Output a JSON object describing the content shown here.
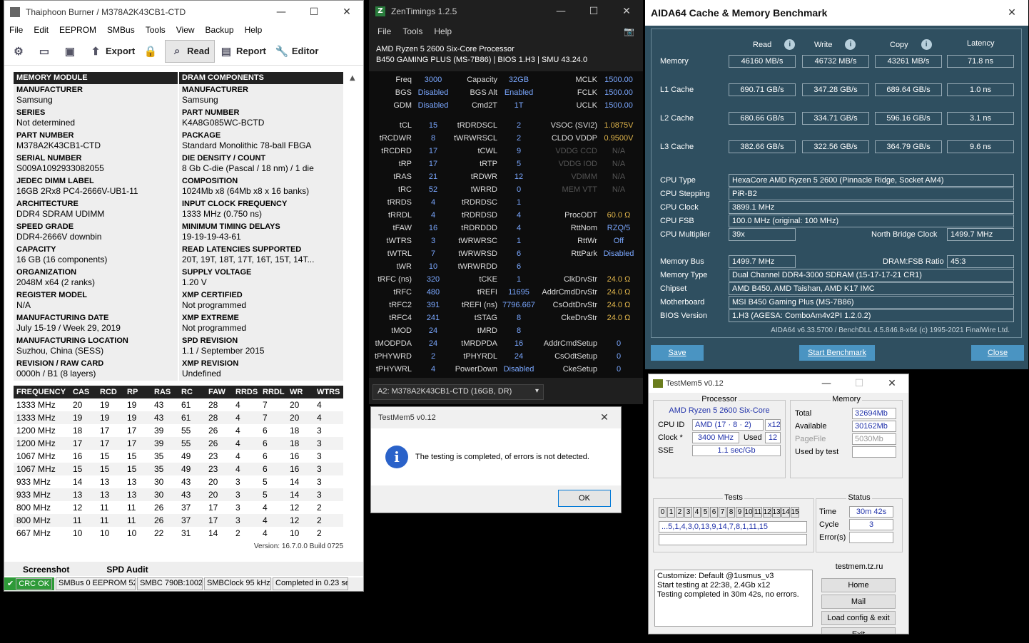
{
  "thaiphoon": {
    "title": "Thaiphoon Burner / M378A2K43CB1-CTD",
    "menu": [
      "File",
      "Edit",
      "EEPROM",
      "SMBus",
      "Tools",
      "View",
      "Backup",
      "Help"
    ],
    "toolbar": {
      "export": "Export",
      "read": "Read",
      "report": "Report",
      "editor": "Editor"
    },
    "spd_headers": [
      "MEMORY MODULE",
      "DRAM COMPONENTS"
    ],
    "spd_rows": [
      [
        {
          "k": "MANUFACTURER",
          "v": "Samsung"
        },
        {
          "k": "MANUFACTURER",
          "v": "Samsung"
        }
      ],
      [
        {
          "k": "SERIES",
          "v": "Not determined"
        },
        {
          "k": "PART NUMBER",
          "v": "K4A8G085WC-BCTD"
        }
      ],
      [
        {
          "k": "PART NUMBER",
          "v": "M378A2K43CB1-CTD"
        },
        {
          "k": "PACKAGE",
          "v": "Standard Monolithic 78-ball FBGA"
        }
      ],
      [
        {
          "k": "SERIAL NUMBER",
          "v": "S009A1092933082055"
        },
        {
          "k": "DIE DENSITY / COUNT",
          "v": "8 Gb C-die (Pascal / 18 nm) / 1 die"
        }
      ],
      [
        {
          "k": "JEDEC DIMM LABEL",
          "v": "16GB 2Rx8 PC4-2666V-UB1-11"
        },
        {
          "k": "COMPOSITION",
          "v": "1024Mb x8 (64Mb x8 x 16 banks)"
        }
      ],
      [
        {
          "k": "ARCHITECTURE",
          "v": "DDR4 SDRAM UDIMM"
        },
        {
          "k": "INPUT CLOCK FREQUENCY",
          "v": "1333 MHz (0.750 ns)"
        }
      ],
      [
        {
          "k": "SPEED GRADE",
          "v": "DDR4-2666V downbin"
        },
        {
          "k": "MINIMUM TIMING DELAYS",
          "v": "19-19-19-43-61"
        }
      ],
      [
        {
          "k": "CAPACITY",
          "v": "16 GB (16 components)"
        },
        {
          "k": "READ LATENCIES SUPPORTED",
          "v": "20T, 19T, 18T, 17T, 16T, 15T, 14T..."
        }
      ],
      [
        {
          "k": "ORGANIZATION",
          "v": "2048M x64 (2 ranks)"
        },
        {
          "k": "SUPPLY VOLTAGE",
          "v": "1.20 V"
        }
      ],
      [
        {
          "k": "REGISTER MODEL",
          "v": "N/A"
        },
        {
          "k": "XMP CERTIFIED",
          "v": "Not programmed"
        }
      ],
      [
        {
          "k": "MANUFACTURING DATE",
          "v": "July 15-19 / Week 29, 2019"
        },
        {
          "k": "XMP EXTREME",
          "v": "Not programmed"
        }
      ],
      [
        {
          "k": "MANUFACTURING LOCATION",
          "v": "Suzhou, China (SESS)"
        },
        {
          "k": "SPD REVISION",
          "v": "1.1 / September 2015"
        }
      ],
      [
        {
          "k": "REVISION / RAW CARD",
          "v": "0000h / B1 (8 layers)"
        },
        {
          "k": "XMP REVISION",
          "v": "Undefined"
        }
      ]
    ],
    "freq_header": [
      "FREQUENCY",
      "CAS",
      "RCD",
      "RP",
      "RAS",
      "RC",
      "FAW",
      "RRDS",
      "RRDL",
      "WR",
      "WTRS"
    ],
    "freq_rows": [
      [
        "1333 MHz",
        "20",
        "19",
        "19",
        "43",
        "61",
        "28",
        "4",
        "7",
        "20",
        "4"
      ],
      [
        "1333 MHz",
        "19",
        "19",
        "19",
        "43",
        "61",
        "28",
        "4",
        "7",
        "20",
        "4"
      ],
      [
        "1200 MHz",
        "18",
        "17",
        "17",
        "39",
        "55",
        "26",
        "4",
        "6",
        "18",
        "3"
      ],
      [
        "1200 MHz",
        "17",
        "17",
        "17",
        "39",
        "55",
        "26",
        "4",
        "6",
        "18",
        "3"
      ],
      [
        "1067 MHz",
        "16",
        "15",
        "15",
        "35",
        "49",
        "23",
        "4",
        "6",
        "16",
        "3"
      ],
      [
        "1067 MHz",
        "15",
        "15",
        "15",
        "35",
        "49",
        "23",
        "4",
        "6",
        "16",
        "3"
      ],
      [
        "933 MHz",
        "14",
        "13",
        "13",
        "30",
        "43",
        "20",
        "3",
        "5",
        "14",
        "3"
      ],
      [
        "933 MHz",
        "13",
        "13",
        "13",
        "30",
        "43",
        "20",
        "3",
        "5",
        "14",
        "3"
      ],
      [
        "800 MHz",
        "12",
        "11",
        "11",
        "26",
        "37",
        "17",
        "3",
        "4",
        "12",
        "2"
      ],
      [
        "800 MHz",
        "11",
        "11",
        "11",
        "26",
        "37",
        "17",
        "3",
        "4",
        "12",
        "2"
      ],
      [
        "667 MHz",
        "10",
        "10",
        "10",
        "22",
        "31",
        "14",
        "2",
        "4",
        "10",
        "2"
      ]
    ],
    "version": "Version: 16.7.0.0 Build 0725",
    "tabs": [
      "Screenshot",
      "SPD Audit"
    ],
    "status": [
      "CRC OK",
      "SMBus 0 EEPROM 52h",
      "SMBC 790B:1002",
      "SMBClock 95 kHz",
      "Completed in 0.23 sec"
    ]
  },
  "zen": {
    "title": "ZenTimings 1.2.5",
    "menu": [
      "File",
      "Tools",
      "Help"
    ],
    "cpu": "AMD Ryzen 5 2600 Six-Core Processor",
    "board": "B450 GAMING PLUS (MS-7B86) | BIOS 1.H3 | SMU 43.24.0",
    "rows": [
      [
        [
          "Freq",
          "3000"
        ],
        [
          "Capacity",
          "32GB"
        ],
        [
          "MCLK",
          "1500.00"
        ]
      ],
      [
        [
          "BGS",
          "Disabled"
        ],
        [
          "BGS Alt",
          "Enabled"
        ],
        [
          "FCLK",
          "1500.00"
        ]
      ],
      [
        [
          "GDM",
          "Disabled"
        ],
        [
          "Cmd2T",
          "1T"
        ],
        [
          "UCLK",
          "1500.00"
        ]
      ],
      [
        [
          "tCL",
          "15"
        ],
        [
          "tRDRDSCL",
          "2"
        ],
        [
          "VSOC (SVI2)",
          "1.0875V"
        ]
      ],
      [
        [
          "tRCDWR",
          "8"
        ],
        [
          "tWRWRSCL",
          "2"
        ],
        [
          "CLDO VDDP",
          "0.9500V"
        ]
      ],
      [
        [
          "tRCDRD",
          "17"
        ],
        [
          "tCWL",
          "9"
        ],
        [
          "VDDG CCD",
          "N/A"
        ]
      ],
      [
        [
          "tRP",
          "17"
        ],
        [
          "tRTP",
          "5"
        ],
        [
          "VDDG IOD",
          "N/A"
        ]
      ],
      [
        [
          "tRAS",
          "21"
        ],
        [
          "tRDWR",
          "12"
        ],
        [
          "VDIMM",
          "N/A"
        ]
      ],
      [
        [
          "tRC",
          "52"
        ],
        [
          "tWRRD",
          "0"
        ],
        [
          "MEM VTT",
          "N/A"
        ]
      ],
      [
        [
          "tRRDS",
          "4"
        ],
        [
          "tRDRDSC",
          "1"
        ],
        [
          "",
          ""
        ]
      ],
      [
        [
          "tRRDL",
          "4"
        ],
        [
          "tRDRDSD",
          "4"
        ],
        [
          "ProcODT",
          "60.0 Ω"
        ]
      ],
      [
        [
          "tFAW",
          "16"
        ],
        [
          "tRDRDDD",
          "4"
        ],
        [
          "RttNom",
          "RZQ/5"
        ]
      ],
      [
        [
          "tWTRS",
          "3"
        ],
        [
          "tWRWRSC",
          "1"
        ],
        [
          "RttWr",
          "Off"
        ]
      ],
      [
        [
          "tWTRL",
          "7"
        ],
        [
          "tWRWRSD",
          "6"
        ],
        [
          "RttPark",
          "Disabled"
        ]
      ],
      [
        [
          "tWR",
          "10"
        ],
        [
          "tWRWRDD",
          "6"
        ],
        [
          "",
          ""
        ]
      ],
      [
        [
          "tRFC (ns)",
          "320"
        ],
        [
          "tCKE",
          "1"
        ],
        [
          "ClkDrvStr",
          "24.0 Ω"
        ]
      ],
      [
        [
          "tRFC",
          "480"
        ],
        [
          "tREFI",
          "11695"
        ],
        [
          "AddrCmdDrvStr",
          "24.0 Ω"
        ]
      ],
      [
        [
          "tRFC2",
          "391"
        ],
        [
          "tREFI (ns)",
          "7796.667"
        ],
        [
          "CsOdtDrvStr",
          "24.0 Ω"
        ]
      ],
      [
        [
          "tRFC4",
          "241"
        ],
        [
          "tSTAG",
          "8"
        ],
        [
          "CkeDrvStr",
          "24.0 Ω"
        ]
      ],
      [
        [
          "tMOD",
          "24"
        ],
        [
          "tMRD",
          "8"
        ],
        [
          "",
          ""
        ]
      ],
      [
        [
          "tMODPDA",
          "24"
        ],
        [
          "tMRDPDA",
          "16"
        ],
        [
          "AddrCmdSetup",
          "0"
        ]
      ],
      [
        [
          "tPHYWRD",
          "2"
        ],
        [
          "tPHYRDL",
          "24"
        ],
        [
          "CsOdtSetup",
          "0"
        ]
      ],
      [
        [
          "tPHYWRL",
          "4"
        ],
        [
          "PowerDown",
          "Disabled"
        ],
        [
          "CkeSetup",
          "0"
        ]
      ]
    ],
    "selector": "A2: M378A2K43CB1-CTD (16GB, DR)"
  },
  "tm_dialog": {
    "title": "TestMem5 v0.12",
    "message": "The testing is completed, of errors is not detected.",
    "ok": "OK"
  },
  "aida": {
    "title": "AIDA64 Cache & Memory Benchmark",
    "cols": [
      "Read",
      "Write",
      "Copy",
      "Latency"
    ],
    "rows": [
      {
        "label": "Memory",
        "vals": [
          "46160 MB/s",
          "46732 MB/s",
          "43261 MB/s",
          "71.8 ns"
        ]
      },
      {
        "label": "L1 Cache",
        "vals": [
          "690.71 GB/s",
          "347.28 GB/s",
          "689.64 GB/s",
          "1.0 ns"
        ]
      },
      {
        "label": "L2 Cache",
        "vals": [
          "680.66 GB/s",
          "334.71 GB/s",
          "596.16 GB/s",
          "3.1 ns"
        ]
      },
      {
        "label": "L3 Cache",
        "vals": [
          "382.66 GB/s",
          "322.56 GB/s",
          "364.79 GB/s",
          "9.6 ns"
        ]
      }
    ],
    "cpu_type_l": "CPU Type",
    "cpu_type": "HexaCore AMD Ryzen 5 2600  (Pinnacle Ridge, Socket AM4)",
    "cpu_step_l": "CPU Stepping",
    "cpu_step": "PiR-B2",
    "cpu_clock_l": "CPU Clock",
    "cpu_clock": "3899.1 MHz",
    "cpu_fsb_l": "CPU FSB",
    "cpu_fsb": "100.0 MHz  (original: 100 MHz)",
    "cpu_mult_l": "CPU Multiplier",
    "cpu_mult": "39x",
    "nb_l": "North Bridge Clock",
    "nb": "1499.7 MHz",
    "mbus_l": "Memory Bus",
    "mbus": "1499.7 MHz",
    "ratio_l": "DRAM:FSB Ratio",
    "ratio": "45:3",
    "mtype_l": "Memory Type",
    "mtype": "Dual Channel DDR4-3000 SDRAM  (15-17-17-21 CR1)",
    "chipset_l": "Chipset",
    "chipset": "AMD B450, AMD Taishan, AMD K17 IMC",
    "mobo_l": "Motherboard",
    "mobo": "MSI B450 Gaming Plus (MS-7B86)",
    "bios_l": "BIOS Version",
    "bios": "1.H3  (AGESA: ComboAm4v2PI 1.2.0.2)",
    "footer": "AIDA64 v6.33.5700 / BenchDLL 4.5.846.8-x64  (c) 1995-2021 FinalWire Ltd.",
    "save": "Save",
    "start": "Start Benchmark",
    "close": "Close"
  },
  "tm": {
    "title": "TestMem5 v0.12",
    "proc_t": "Processor",
    "proc": "AMD Ryzen 5 2600 Six-Core",
    "cpuid_l": "CPU ID",
    "cpuid": "AMD  (17 · 8 · 2)",
    "cpuid_x": "x12",
    "clock_l": "Clock *",
    "clock": "3400 MHz",
    "used_l": "Used",
    "used": "12",
    "sse_l": "SSE",
    "sse": "1.1 sec/Gb",
    "mem_t": "Memory",
    "total_l": "Total",
    "total": "32694Mb",
    "avail_l": "Available",
    "avail": "30162Mb",
    "page_l": "PageFile",
    "page": "5030Mb",
    "usedby_l": "Used by test",
    "usedby": "",
    "tests_t": "Tests",
    "cells": [
      "0",
      "1",
      "2",
      "3",
      "4",
      "5",
      "6",
      "7",
      "8",
      "9",
      "10",
      "11",
      "12",
      "13",
      "14",
      "15"
    ],
    "seq": "...5,1,4,3,0,13,9,14,7,8,1,11,15",
    "status_t": "Status",
    "time_l": "Time",
    "time": "30m 42s",
    "cycle_l": "Cycle",
    "cycle": "3",
    "err_l": "Error(s)",
    "err": "",
    "log": [
      "Customize: Default @1usmus_v3",
      "Start testing at 22:38, 2.4Gb x12",
      "Testing completed in 30m 42s, no errors."
    ],
    "site": "testmem.tz.ru",
    "btns": [
      "Home",
      "Mail",
      "Load config & exit",
      "Exit"
    ]
  }
}
